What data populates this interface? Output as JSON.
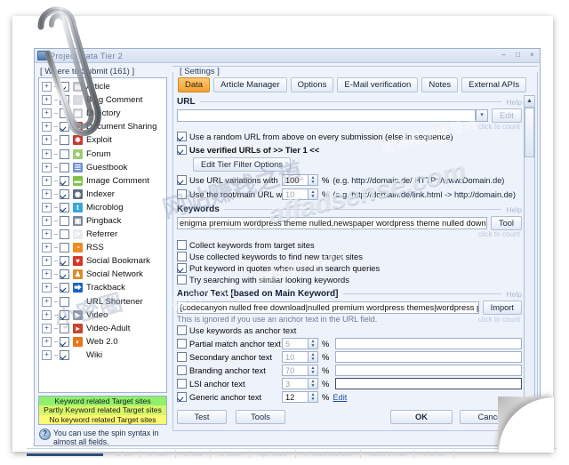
{
  "window": {
    "title": "Project Data   Tier 2",
    "minimize": "–",
    "maximize": "□",
    "close": "×"
  },
  "left_panel": {
    "group_label": "[ Where to Submit  (161) ]",
    "expander": "+",
    "items": [
      {
        "label": "Article",
        "checked": true,
        "icon": "article-icon",
        "color": "#b9bcc1",
        "glyph": "▤"
      },
      {
        "label": "Blog Comment",
        "checked": true,
        "icon": "blog-comment-icon",
        "color": "#d7d9dd",
        "glyph": "○"
      },
      {
        "label": "Directory",
        "checked": false,
        "icon": "directory-icon",
        "color": "#c9ccd2",
        "glyph": "▦"
      },
      {
        "label": "Document Sharing",
        "checked": true,
        "icon": "document-sharing-icon",
        "color": "#b1463a",
        "glyph": "❐"
      },
      {
        "label": "Exploit",
        "checked": false,
        "icon": "exploit-icon",
        "color": "#c83a2e",
        "glyph": "✹"
      },
      {
        "label": "Forum",
        "checked": false,
        "icon": "forum-icon",
        "color": "#9dcb6f",
        "glyph": "☻"
      },
      {
        "label": "Guestbook",
        "checked": false,
        "icon": "guestbook-icon",
        "color": "#6f93d4",
        "glyph": "☰"
      },
      {
        "label": "Image Comment",
        "checked": true,
        "icon": "image-comment-icon",
        "color": "#7fc24a",
        "glyph": "▬"
      },
      {
        "label": "Indexer",
        "checked": true,
        "icon": "indexer-icon",
        "color": "#5d6c80",
        "glyph": "◉"
      },
      {
        "label": "Microblog",
        "checked": true,
        "icon": "microblog-icon",
        "color": "#39a6dd",
        "glyph": "t"
      },
      {
        "label": "Pingback",
        "checked": false,
        "icon": "pingback-icon",
        "color": "#7a8594",
        "glyph": "▣"
      },
      {
        "label": "Referrer",
        "checked": false,
        "icon": "referrer-icon",
        "color": "#e8eaee",
        "glyph": "⟳"
      },
      {
        "label": "RSS",
        "checked": false,
        "icon": "rss-icon",
        "color": "#f08a24",
        "glyph": "◔"
      },
      {
        "label": "Social Bookmark",
        "checked": true,
        "icon": "social-bookmark-icon",
        "color": "#d8352a",
        "glyph": "♥"
      },
      {
        "label": "Social Network",
        "checked": true,
        "icon": "social-network-icon",
        "color": "#e08b2f",
        "glyph": "♟"
      },
      {
        "label": "Trackback",
        "checked": true,
        "icon": "trackback-icon",
        "color": "#1b63c4",
        "glyph": "⮕"
      },
      {
        "label": "URL Shortener",
        "checked": false,
        "icon": "url-shortener-icon",
        "color": "#ffffff",
        "glyph": "»"
      },
      {
        "label": "Video",
        "checked": true,
        "icon": "video-icon",
        "color": "#8e98a6",
        "glyph": "▶"
      },
      {
        "label": "Video-Adult",
        "checked": false,
        "icon": "video-adult-icon",
        "color": "#c9432c",
        "glyph": "▸"
      },
      {
        "label": "Web 2.0",
        "checked": true,
        "icon": "web20-icon",
        "color": "#e8761b",
        "glyph": "◐"
      },
      {
        "label": "Wiki",
        "checked": true,
        "icon": "wiki-icon",
        "color": "#ffffff",
        "glyph": "W"
      }
    ],
    "legend": [
      {
        "text": "Keyword related Target sites",
        "color": "#8ff06a"
      },
      {
        "text": "Partly Keyword related Target sites",
        "color": "#d6f56a"
      },
      {
        "text": "No keyword related Target sites",
        "color": "#fbf871"
      }
    ],
    "hint": {
      "icon_glyph": "?",
      "line1": "You can use the spin syntax in",
      "line2": "almost all fields."
    }
  },
  "settings": {
    "caption": "[ Settings ]",
    "tabs": [
      {
        "label": "Data",
        "active": true
      },
      {
        "label": "Article Manager",
        "active": false
      },
      {
        "label": "Options",
        "active": false
      },
      {
        "label": "E-Mail verification",
        "active": false
      },
      {
        "label": "Notes",
        "active": false
      },
      {
        "label": "External APIs",
        "active": false
      }
    ],
    "help_label": "Help",
    "click_to_count": "click to count",
    "url_section": {
      "title": "URL",
      "value": "",
      "edit_button": "Edit",
      "combo_arrow": "▾",
      "check_random": {
        "label": "Use a random URL from above on every submission (else in sequence)",
        "checked": true
      },
      "check_verified": {
        "label": "Use verified URLs of >> Tier 1 <<",
        "checked": true,
        "bold": true
      },
      "tier_filter_button": "Edit Tier Filter Options",
      "url_variations": {
        "label": "Use URL variations with",
        "checked": true,
        "value": "100",
        "percent": "%",
        "example": "(e.g. http://domain.de/ HTTP://www.Domain.de)"
      },
      "root_url": {
        "label": "Use the root/main URL with",
        "checked": false,
        "value": "10",
        "percent": "%",
        "example": "(e.g. http://domain.de/link.html -> http://domain.de)"
      }
    },
    "keywords_section": {
      "title": "Keywords",
      "value": "enigma premium wordpress theme nulled,newspaper wordpress theme nulled download,shopme - econ",
      "tool_button": "Tool",
      "checks": [
        {
          "label": "Collect keywords from target sites",
          "checked": false
        },
        {
          "label": "Use collected keywords to find new target sites",
          "checked": false
        },
        {
          "label": "Put keyword in quotes when used in search queries",
          "checked": true
        },
        {
          "label": "Try searching with similar looking keywords",
          "checked": false
        }
      ]
    },
    "anchor_section": {
      "title": "Anchor Text [based on Main Keyword]",
      "value": "{codecanyon nulled free download|nulled premium wordpress themes|wordpress premium templates n",
      "import_button": "Import",
      "note": "This is ignored if you use an anchor text in the URL field.",
      "use_keywords_as_anchor": {
        "label": "Use keywords as anchor text",
        "checked": false
      },
      "rows": [
        {
          "label": "Partial match anchor text",
          "checked": false,
          "value": "5",
          "percent": "%",
          "gray": true,
          "text": "",
          "focus": false
        },
        {
          "label": "Secondary anchor text",
          "checked": false,
          "value": "10",
          "percent": "%",
          "gray": true,
          "text": "",
          "focus": false
        },
        {
          "label": "Branding anchor text",
          "checked": false,
          "value": "70",
          "percent": "%",
          "gray": true,
          "text": "",
          "focus": false
        },
        {
          "label": "LSI anchor text",
          "checked": false,
          "value": "3",
          "percent": "%",
          "gray": true,
          "text": "",
          "focus": true
        },
        {
          "label": "Generic anchor text",
          "checked": true,
          "value": "12",
          "percent": "%",
          "gray": false,
          "text": "",
          "focus": false,
          "edit_link": "Edit"
        }
      ]
    },
    "buttons": {
      "test": "Test",
      "tools": "Tools",
      "ok": "OK",
      "cancel": "Cancel"
    }
  },
  "background_strip": {
    "segments": [
      "1. 10",
      "0. 000",
      "1. 001",
      "1. 1000",
      "Apr. 2020",
      "0. 0010/000-000",
      "Main: 27018",
      "0/ 0/ 00"
    ]
  },
  "watermarks": {
    "site": "affadsense.com",
    "cn1": "黑帽技能传播者",
    "cn2": "网站赚钱之道",
    "cn3": "小密圈",
    "cn4": "微信公众",
    "url": "https://www"
  }
}
